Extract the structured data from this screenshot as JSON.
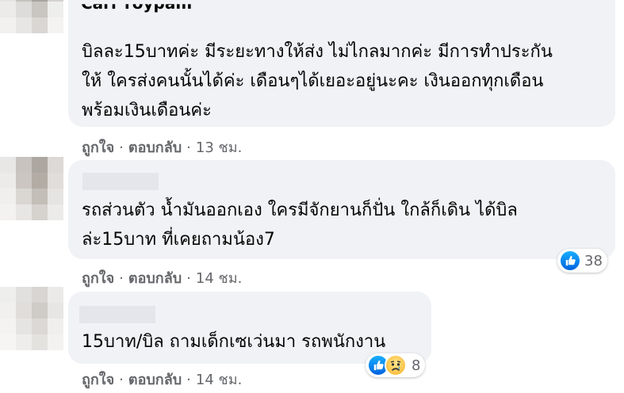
{
  "comments": [
    {
      "name_partial": "Carr roypam",
      "lines": [
        "บิลละ15บาทค่ะ มีระยะทางให้ส่ง ไม่ไกลมากค่ะ มีการทำประกัน",
        "ให้ ใครส่งคนนั้นได้ค่ะ เดือนๆได้เยอะอยู่นะคะ เงินออกทุกเดือน",
        "พร้อมเงินเดือนค่ะ"
      ],
      "like": "ถูกใจ",
      "reply": "ตอบกลับ",
      "time": "13 ชม."
    },
    {
      "lines": [
        "รถส่วนตัว น้ำมันออกเอง ใครมีจักยานก็ปั่น ใกล้ก็เดิน ได้บิล",
        "ล่ะ15บาท ที่เคยถามน้อง7"
      ],
      "like": "ถูกใจ",
      "reply": "ตอบกลับ",
      "time": "14 ชม.",
      "reaction_count": "38"
    },
    {
      "lines": [
        "15บาท/บิล ถามเด็กเซเว่นมา รถพนักงาน"
      ],
      "like": "ถูกใจ",
      "reply": "ตอบกลับ",
      "time": "14 ชม.",
      "reaction_count": "8"
    }
  ],
  "separator": "·",
  "colors": {
    "bubble": "#f0f2f5",
    "text": "#050505",
    "meta": "#65676b",
    "like_blue": "#1877f2"
  },
  "icons": {
    "reaction_like": "like-icon",
    "reaction_sad": "sad-icon"
  }
}
